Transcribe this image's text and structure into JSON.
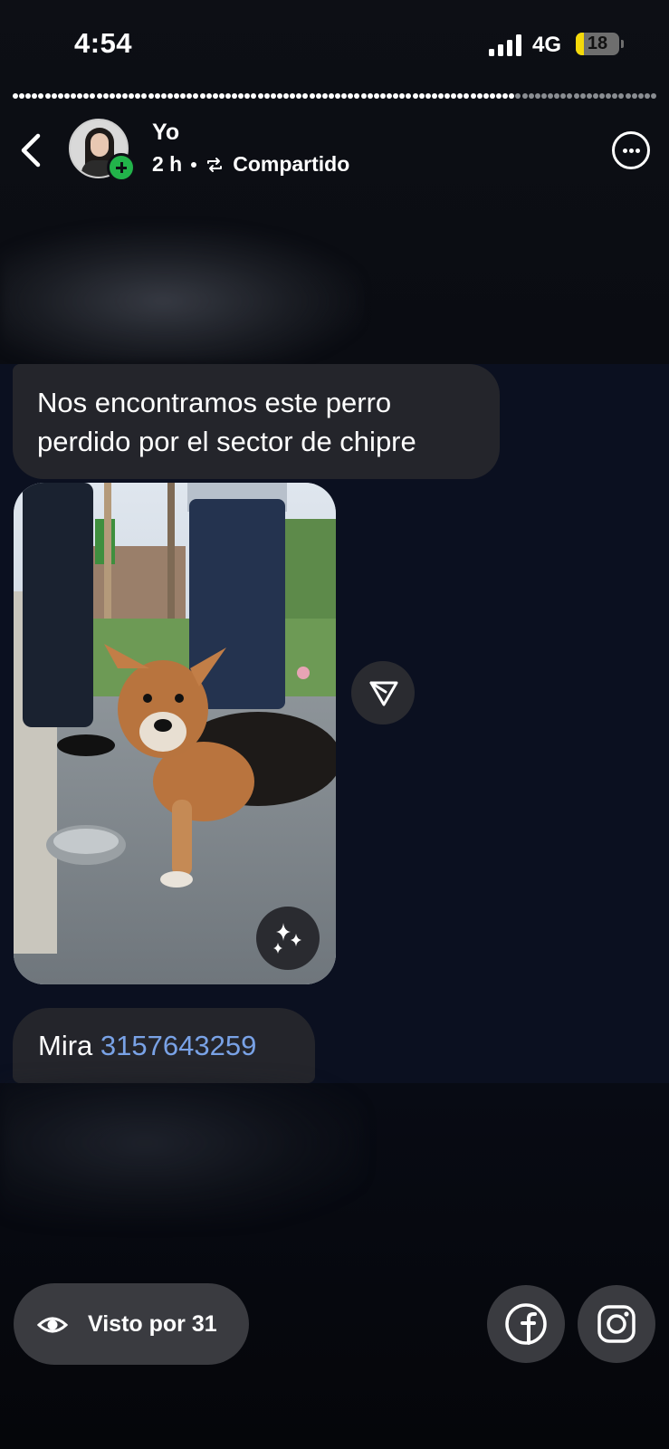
{
  "status_bar": {
    "time": "4:54",
    "network": "4G",
    "battery_level": "18",
    "battery_color": "#f5d90a"
  },
  "story": {
    "segments_viewed": 78,
    "segments_total": 100
  },
  "header": {
    "user_name": "Yo",
    "time_ago": "2 h",
    "shared_label": "Compartido",
    "icons": [
      "back-chevron-icon",
      "add-story-icon",
      "repost-icon",
      "more-options-icon"
    ]
  },
  "chat_screenshot": {
    "message_line1": "Nos encontramos este perro",
    "message_line2": "perdido por el sector de chipre",
    "reply_prefix": "Mira",
    "phone_number": "3157643259",
    "link_color": "#79a2e6",
    "icons": [
      "share-arrow-icon",
      "ai-sparkle-icon"
    ]
  },
  "footer": {
    "viewers_label": "Visto por 31",
    "icons": [
      "eye-icon",
      "facebook-icon",
      "instagram-icon"
    ]
  }
}
